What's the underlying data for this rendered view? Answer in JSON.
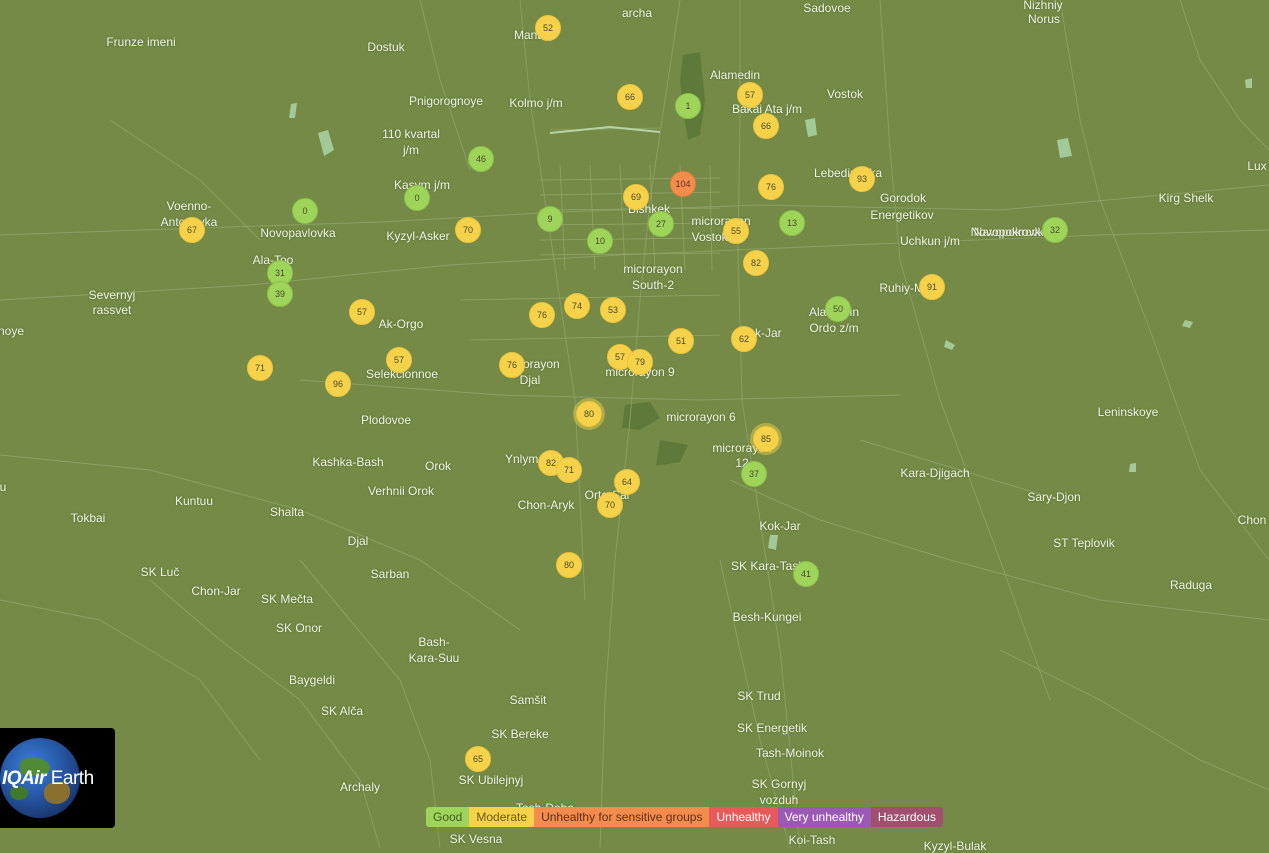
{
  "colors": {
    "map_background": "#748a46",
    "good": "#9fd45a",
    "moderate": "#f6d24b",
    "usg": "#f48c4e",
    "unhealthy": "#e85a5a",
    "very_unhealthy": "#9b59b6",
    "hazardous": "#a04f6e"
  },
  "logo": {
    "brand_bold": "IQAir",
    "brand_rest": " Earth"
  },
  "legend": [
    {
      "label": "Good",
      "color": "#9fd45a",
      "text_color": "#4a5a2a"
    },
    {
      "label": "Moderate",
      "color": "#f6d24b",
      "text_color": "#6a5a1a"
    },
    {
      "label": "Unhealthy for sensitive groups",
      "color": "#f48c4e",
      "text_color": "#5a3218"
    },
    {
      "label": "Unhealthy",
      "color": "#e85a5a",
      "text_color": "#ffffff"
    },
    {
      "label": "Very unhealthy",
      "color": "#9b59b6",
      "text_color": "#ffffff"
    },
    {
      "label": "Hazardous",
      "color": "#a04f6e",
      "text_color": "#ffffff"
    }
  ],
  "places": [
    "Frunze imeni",
    "Dostuk",
    "Manas",
    "archa",
    "Sadovoe",
    "Nizhniy",
    "Norus",
    "Alamedin",
    "Bakai Ata j/m",
    "Vostok",
    "Pnigorognoye",
    "Kolmo j/m",
    "110 kvartal",
    "j/m",
    "Lebedinovka",
    "Kasym j/m",
    "Gorodok",
    "Energetikov",
    "Kirg Shelk",
    "Lux",
    "Voenno-",
    "Antonovka",
    "Novopavlovka",
    "Kyzyl-Asker",
    "Bishkek",
    "microrayon",
    "Vostok-5",
    "Uchkun j/m",
    "Navopokrovka",
    "Ala-Too",
    "microrayon",
    "South-2",
    "Severnyj",
    "rassvet",
    "noye",
    "Ruhiy-Mirat",
    "Ak-Orgo",
    "Alamedin",
    "Ordo z/m",
    "Kok-Jar",
    "microrayon",
    "Djal",
    "microrayon 9",
    "Selekcionnoe",
    "Plodovoe",
    "microrayon 6",
    "Leninskoye",
    "microrayon",
    "12",
    "Kashka-Bash",
    "Orok",
    "Ynlymak",
    "Kara-Djigach",
    "Verhnii Orok",
    "Chon-Aryk",
    "Orto-Sai",
    "Sary-Djon",
    "Kuntuu",
    "Tokbai",
    "Shalta",
    "Kok-Jar",
    "Chon",
    "ST Teplovik",
    "Djal",
    "SK Luč",
    "Sarban",
    "SK Kara-Tash",
    "Raduga",
    "Chon-Jar",
    "SK Mečta",
    "Besh-Kungei",
    "SK Onor",
    "Bash-",
    "Kara-Suu",
    "Baygeldi",
    "SK Trud",
    "Samšit",
    "SK Alča",
    "SK Energetik",
    "SK Bereke",
    "Tash-Moinok",
    "Novopokrovka",
    "SK Gornyj",
    "vozduh",
    "SK Ubilejnyj",
    "Archaly",
    "Tash-Dobo",
    "SK Vesna",
    "Koi-Tash",
    "Kyzyl-Bulak",
    "u"
  ],
  "stations": [
    {
      "value": "52",
      "level": "moderate"
    },
    {
      "value": "66",
      "level": "moderate"
    },
    {
      "value": "1",
      "level": "good"
    },
    {
      "value": "57",
      "level": "moderate"
    },
    {
      "value": "66",
      "level": "moderate"
    },
    {
      "value": "46",
      "level": "good"
    },
    {
      "value": "104",
      "level": "usg"
    },
    {
      "value": "69",
      "level": "moderate"
    },
    {
      "value": "76",
      "level": "moderate"
    },
    {
      "value": "93",
      "level": "moderate"
    },
    {
      "value": "0",
      "level": "good"
    },
    {
      "value": "0",
      "level": "good"
    },
    {
      "value": "67",
      "level": "moderate"
    },
    {
      "value": "70",
      "level": "moderate"
    },
    {
      "value": "9",
      "level": "good"
    },
    {
      "value": "27",
      "level": "good"
    },
    {
      "value": "55",
      "level": "moderate"
    },
    {
      "value": "13",
      "level": "good"
    },
    {
      "value": "32",
      "level": "good"
    },
    {
      "value": "10",
      "level": "good"
    },
    {
      "value": "82",
      "level": "moderate"
    },
    {
      "value": "31",
      "level": "good"
    },
    {
      "value": "39",
      "level": "good"
    },
    {
      "value": "91",
      "level": "moderate"
    },
    {
      "value": "57",
      "level": "moderate"
    },
    {
      "value": "76",
      "level": "moderate"
    },
    {
      "value": "74",
      "level": "moderate"
    },
    {
      "value": "53",
      "level": "moderate"
    },
    {
      "value": "50",
      "level": "good"
    },
    {
      "value": "51",
      "level": "moderate"
    },
    {
      "value": "62",
      "level": "moderate"
    },
    {
      "value": "71",
      "level": "moderate"
    },
    {
      "value": "57",
      "level": "moderate"
    },
    {
      "value": "76",
      "level": "moderate"
    },
    {
      "value": "57",
      "level": "moderate"
    },
    {
      "value": "79",
      "level": "moderate"
    },
    {
      "value": "96",
      "level": "moderate"
    },
    {
      "value": "80",
      "level": "moderate"
    },
    {
      "value": "85",
      "level": "moderate"
    },
    {
      "value": "82",
      "level": "moderate"
    },
    {
      "value": "71",
      "level": "moderate"
    },
    {
      "value": "37",
      "level": "good"
    },
    {
      "value": "64",
      "level": "moderate"
    },
    {
      "value": "70",
      "level": "moderate"
    },
    {
      "value": "80",
      "level": "moderate"
    },
    {
      "value": "41",
      "level": "good"
    },
    {
      "value": "65",
      "level": "moderate"
    }
  ]
}
